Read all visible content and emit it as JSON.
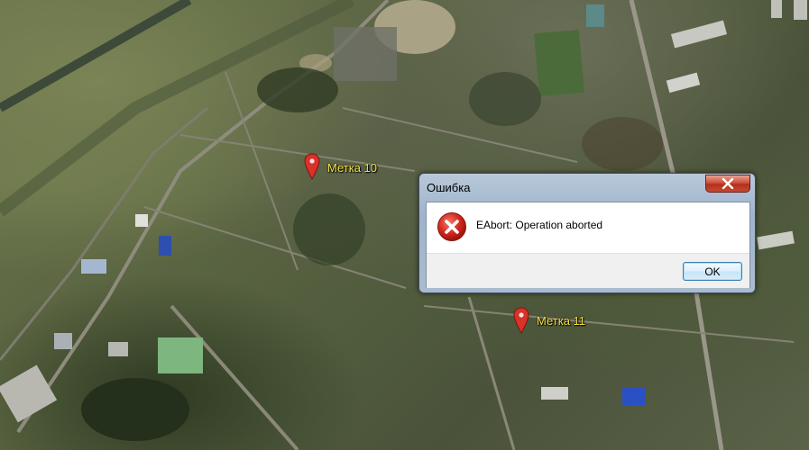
{
  "map": {
    "markers": [
      {
        "label": "Метка 10",
        "icon": "map-pin-icon"
      },
      {
        "label": "Метка 11",
        "icon": "map-pin-icon"
      }
    ]
  },
  "dialog": {
    "title": "Ошибка",
    "message": "EAbort: Operation aborted",
    "ok_label": "OK",
    "icon": "error-icon",
    "close_icon": "close-icon"
  },
  "colors": {
    "marker_red": "#d8322a",
    "label_yellow": "#f0e046",
    "close_red": "#c7412c",
    "ok_border": "#3c7fb1"
  }
}
